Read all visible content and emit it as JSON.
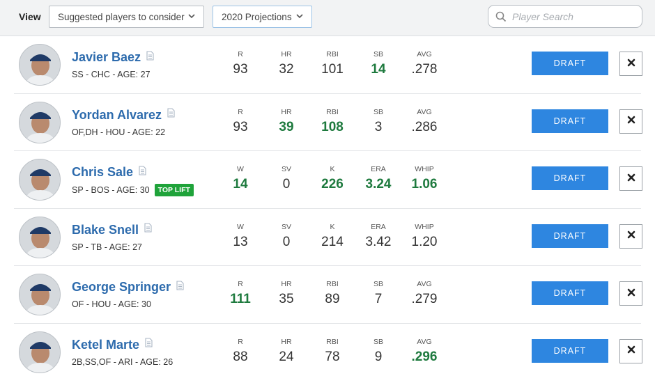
{
  "toolbar": {
    "view_label": "View",
    "view_select": "Suggested players to consider",
    "projection_select": "2020 Projections",
    "search_placeholder": "Player Search"
  },
  "icons": {
    "select_arrow": "chevron-down-icon",
    "search": "search-icon",
    "notes": "document-icon",
    "remove": "close-icon"
  },
  "colors": {
    "link": "#2d6bad",
    "highlight_stat": "#1e7a3e",
    "draft_button": "#2e86e0",
    "badge": "#1fa33a"
  },
  "draft_label": "DRAFT",
  "players": [
    {
      "name": "Javier Baez",
      "meta": "SS - CHC - AGE: 27",
      "badge": "",
      "stats": [
        {
          "label": "R",
          "value": "93",
          "hi": false
        },
        {
          "label": "HR",
          "value": "32",
          "hi": false
        },
        {
          "label": "RBI",
          "value": "101",
          "hi": false
        },
        {
          "label": "SB",
          "value": "14",
          "hi": true
        },
        {
          "label": "AVG",
          "value": ".278",
          "hi": false
        }
      ]
    },
    {
      "name": "Yordan Alvarez",
      "meta": "OF,DH - HOU - AGE: 22",
      "badge": "",
      "stats": [
        {
          "label": "R",
          "value": "93",
          "hi": false
        },
        {
          "label": "HR",
          "value": "39",
          "hi": true
        },
        {
          "label": "RBI",
          "value": "108",
          "hi": true
        },
        {
          "label": "SB",
          "value": "3",
          "hi": false
        },
        {
          "label": "AVG",
          "value": ".286",
          "hi": false
        }
      ]
    },
    {
      "name": "Chris Sale",
      "meta": "SP - BOS - AGE: 30",
      "badge": "TOP LIFT",
      "stats": [
        {
          "label": "W",
          "value": "14",
          "hi": true
        },
        {
          "label": "SV",
          "value": "0",
          "hi": false
        },
        {
          "label": "K",
          "value": "226",
          "hi": true
        },
        {
          "label": "ERA",
          "value": "3.24",
          "hi": true
        },
        {
          "label": "WHIP",
          "value": "1.06",
          "hi": true
        }
      ]
    },
    {
      "name": "Blake Snell",
      "meta": "SP - TB - AGE: 27",
      "badge": "",
      "stats": [
        {
          "label": "W",
          "value": "13",
          "hi": false
        },
        {
          "label": "SV",
          "value": "0",
          "hi": false
        },
        {
          "label": "K",
          "value": "214",
          "hi": false
        },
        {
          "label": "ERA",
          "value": "3.42",
          "hi": false
        },
        {
          "label": "WHIP",
          "value": "1.20",
          "hi": false
        }
      ]
    },
    {
      "name": "George Springer",
      "meta": "OF - HOU - AGE: 30",
      "badge": "",
      "stats": [
        {
          "label": "R",
          "value": "111",
          "hi": true
        },
        {
          "label": "HR",
          "value": "35",
          "hi": false
        },
        {
          "label": "RBI",
          "value": "89",
          "hi": false
        },
        {
          "label": "SB",
          "value": "7",
          "hi": false
        },
        {
          "label": "AVG",
          "value": ".279",
          "hi": false
        }
      ]
    },
    {
      "name": "Ketel Marte",
      "meta": "2B,SS,OF - ARI - AGE: 26",
      "badge": "",
      "stats": [
        {
          "label": "R",
          "value": "88",
          "hi": false
        },
        {
          "label": "HR",
          "value": "24",
          "hi": false
        },
        {
          "label": "RBI",
          "value": "78",
          "hi": false
        },
        {
          "label": "SB",
          "value": "9",
          "hi": false
        },
        {
          "label": "AVG",
          "value": ".296",
          "hi": true
        }
      ]
    }
  ]
}
